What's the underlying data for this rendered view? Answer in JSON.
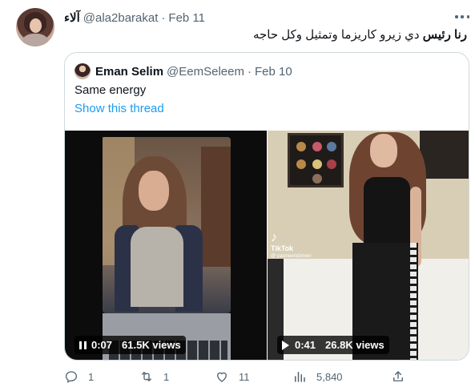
{
  "tweet": {
    "author_name": "آلاء",
    "author_handle": "@ala2barakat",
    "separator": "·",
    "date": "Feb 11",
    "text_bold": "رنا رئيس",
    "text_rest": " دي زيرو كاريزما وتمثيل وكل حاجه"
  },
  "quote": {
    "author_name": "Eman Selim",
    "author_handle": "@EemSeleem",
    "separator": "·",
    "date": "Feb 10",
    "text": "Same energy",
    "thread_link": "Show this thread"
  },
  "videos": [
    {
      "duration": "0:07",
      "views": "61.5K views",
      "state": "paused"
    },
    {
      "duration": "0:41",
      "views": "26.8K views",
      "state": "playing",
      "watermark": "TikTok",
      "watermark_user": "@ yasmeendomerr"
    }
  ],
  "actions": {
    "replies": "1",
    "retweets": "1",
    "likes": "11",
    "views": "5,840"
  },
  "colors": {
    "link": "#1d9bf0",
    "secondary_text": "#536471",
    "border": "#cfd9de"
  }
}
